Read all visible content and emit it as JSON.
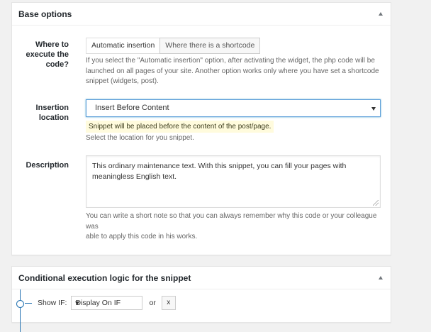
{
  "base_options": {
    "title": "Base options",
    "where": {
      "label": "Where to execute the code?",
      "label_lines": [
        "Where to",
        "execute the",
        "code?"
      ],
      "options": [
        "Automatic insertion",
        "Where there is a shortcode"
      ],
      "selected": "Automatic insertion",
      "help_lines": [
        "If you select the \"Automatic insertion\" option, after activating the widget, the php code will be",
        "launched on all pages of your site. Another option works only where you have set a shortcode",
        "snippet (widgets, post)."
      ]
    },
    "insertion": {
      "label_lines": [
        "Insertion",
        "location"
      ],
      "value": "Insert Before Content",
      "notice": "Snippet will be placed before the content of the post/page.",
      "help": "Select the location for you snippet."
    },
    "description": {
      "label": "Description",
      "value_lines": [
        "This ordinary maintenance text. With this snippet, you can fill your pages with",
        "meaningless English text."
      ],
      "help_lines": [
        "You can write a short note so that you can always remember why this code or your colleague was",
        "able to apply this code in his works."
      ]
    }
  },
  "conditional": {
    "title": "Conditional execution logic for the snippet",
    "show_if_label": "Show IF:",
    "select_value": "Display On IF",
    "or_label": "or",
    "remove_label": "x"
  },
  "colors": {
    "accent": "#2271b1",
    "focus_border": "#5b9dd9",
    "notice_bg": "#fffbdd"
  }
}
